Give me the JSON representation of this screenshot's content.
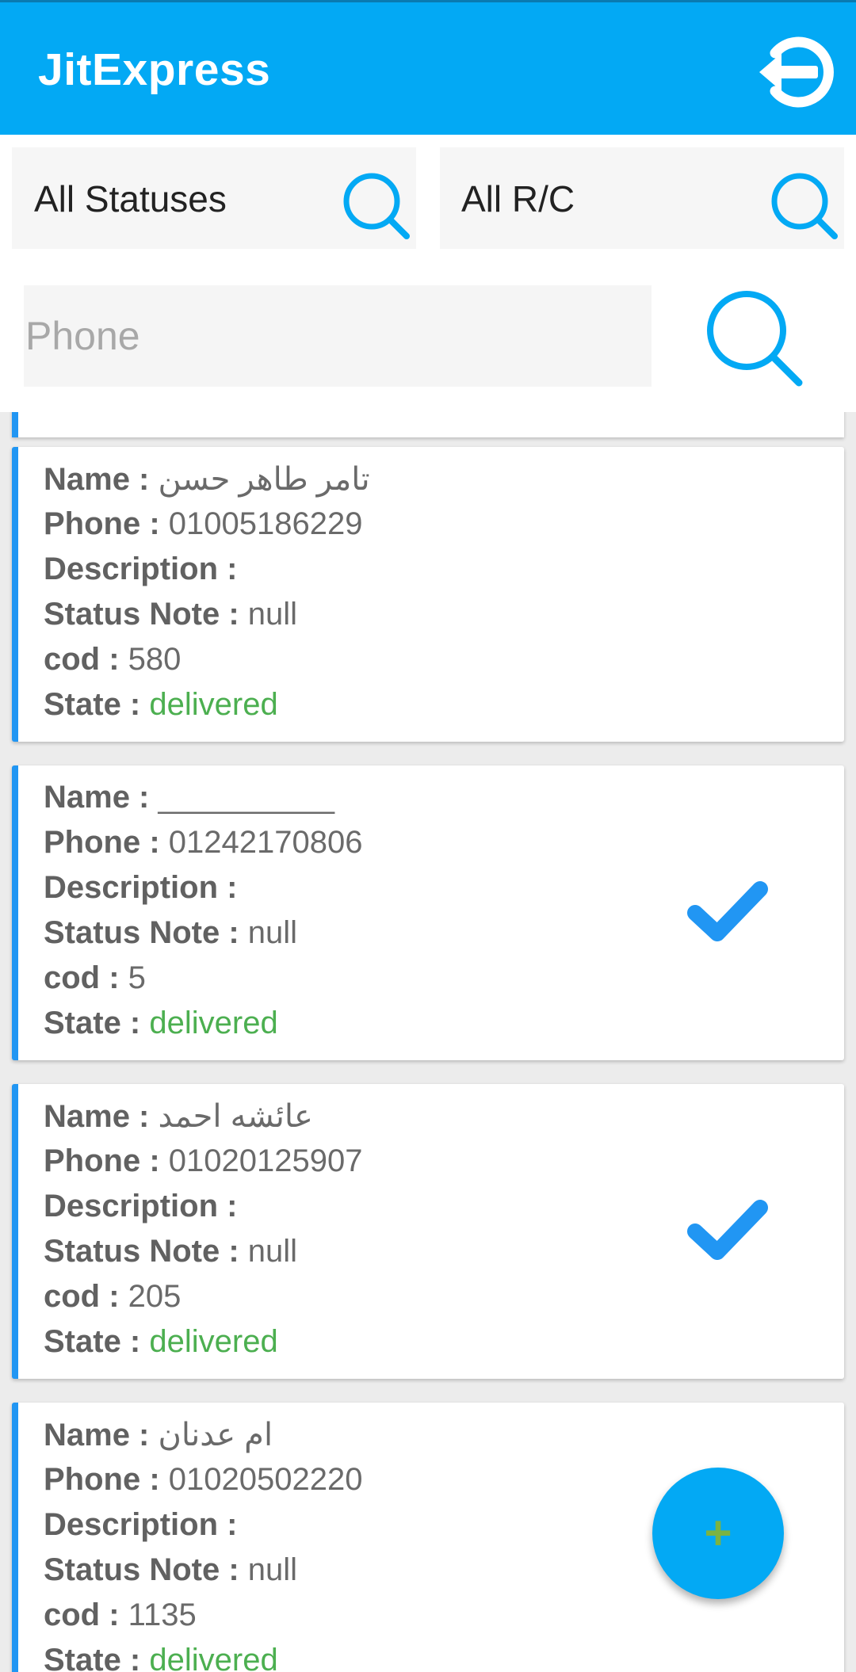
{
  "app": {
    "title": "JitExpress",
    "logout_icon": "logout-icon"
  },
  "filters": {
    "status": {
      "value": "All Statuses",
      "icon": "search-icon"
    },
    "rc": {
      "value": "All R/C",
      "icon": "search-icon"
    },
    "phone": {
      "placeholder": "Phone",
      "value": "",
      "icon": "search-icon"
    }
  },
  "labels": {
    "name": "Name : ",
    "phone": "Phone : ",
    "description": "Description : ",
    "status_note": "Status Note : ",
    "cod": "cod : ",
    "state": "State : "
  },
  "orders": [
    {
      "name": "تامر طاهر حسن",
      "phone": "01005186229",
      "description": "",
      "status_note": "null",
      "cod": "580",
      "state": "delivered",
      "checked": false
    },
    {
      "name": "__________",
      "phone": "01242170806",
      "description": "",
      "status_note": "null",
      "cod": "5",
      "state": "delivered",
      "checked": true
    },
    {
      "name": "عائشه احمد",
      "phone": "01020125907",
      "description": "",
      "status_note": "null",
      "cod": "205",
      "state": "delivered",
      "checked": true
    },
    {
      "name": "ام عدنان",
      "phone": "01020502220",
      "description": "",
      "status_note": "null",
      "cod": "1135",
      "state": "delivered",
      "checked": false
    }
  ],
  "fab": {
    "label": "+",
    "icon": "plus-icon"
  },
  "colors": {
    "primary": "#03A9F4",
    "card_accent": "#2196F3",
    "state_delivered": "#4CAF50",
    "fab_plus": "#7CB342"
  }
}
